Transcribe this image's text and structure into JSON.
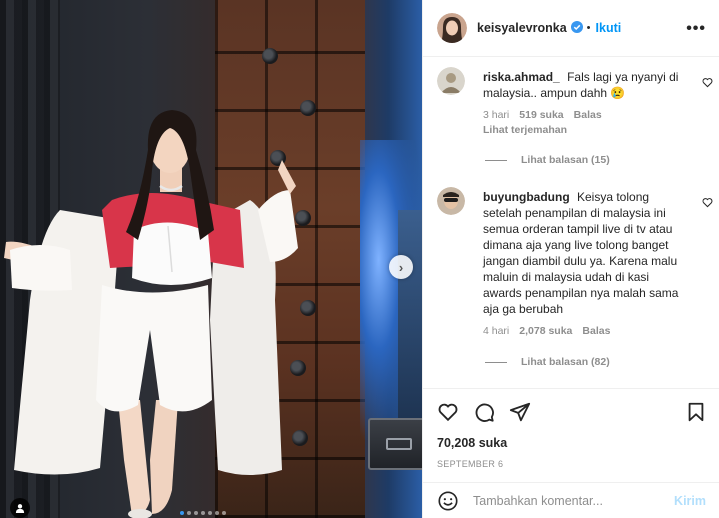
{
  "post": {
    "author": "keisyalevronka",
    "follow_label": "Ikuti",
    "bullet": "•",
    "more_label": "•••",
    "likes": "70,208 suka",
    "date": "SEPTEMBER 6",
    "carousel": {
      "total_slides": 7,
      "current_slide": 1
    }
  },
  "comments": [
    {
      "user": "riska.ahmad_",
      "text": "Fals lagi ya nyanyi di malaysia.. ampun dahh 😢",
      "time": "3 hari",
      "likes": "519 suka",
      "reply_label": "Balas",
      "translate_label": "Lihat terjemahan",
      "view_replies": "Lihat balasan (15)"
    },
    {
      "user": "buyungbadung",
      "text": "Keisya tolong setelah penampilan di malaysia ini semua orderan tampil live di tv atau dimana aja yang live tolong banget jangan diambil dulu ya. Karena malu maluin di malaysia udah di kasi awards penampilan nya malah sama aja ga berubah",
      "time": "4 hari",
      "likes": "2,078 suka",
      "reply_label": "Balas",
      "view_replies": "Lihat balasan (82)"
    }
  ],
  "composer": {
    "placeholder": "Tambahkan komentar...",
    "post_label": "Kirim"
  },
  "carousel_next": "›",
  "colors": {
    "accent": "#0095f6",
    "verified": "#3897f0",
    "muted": "#8e8e8e",
    "post_disabled": "#b2dffc"
  },
  "icons": [
    "verified-badge-icon",
    "heart-icon",
    "comment-icon",
    "share-icon",
    "bookmark-icon",
    "emoji-icon",
    "more-icon",
    "chevron-right-icon",
    "user-tag-icon"
  ]
}
